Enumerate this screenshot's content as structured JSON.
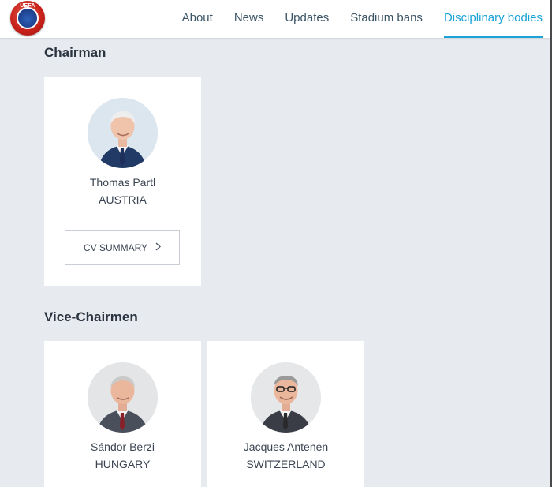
{
  "header": {
    "logo_text": "UEFA",
    "nav": [
      {
        "label": "About",
        "active": false
      },
      {
        "label": "News",
        "active": false
      },
      {
        "label": "Updates",
        "active": false
      },
      {
        "label": "Stadium bans",
        "active": false
      },
      {
        "label": "Disciplinary bodies",
        "active": true
      }
    ],
    "accent_color": "#1aa3d6"
  },
  "sections": [
    {
      "title": "Chairman",
      "members": [
        {
          "name": "Thomas Partl",
          "country": "AUSTRIA",
          "button": "CV SUMMARY",
          "button_icon": "chevron-right-icon"
        }
      ]
    },
    {
      "title": "Vice-Chairmen",
      "members": [
        {
          "name": "Sándor Berzi",
          "country": "HUNGARY"
        },
        {
          "name": "Jacques Antenen",
          "country": "SWITZERLAND"
        }
      ]
    }
  ]
}
